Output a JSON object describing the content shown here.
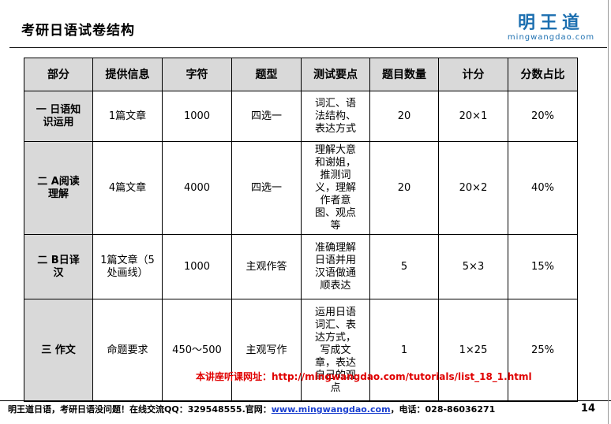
{
  "slide": {
    "title": "考研日语试卷结构",
    "logo_cn": "明王道",
    "logo_en": "mingwangdao.com",
    "page_number": "14"
  },
  "table": {
    "headers": [
      "部分",
      "提供信息",
      "字符",
      "题型",
      "测试要点",
      "题目数量",
      "计分",
      "分数占比"
    ],
    "rows": [
      {
        "part": "一 日语知识运用",
        "info": "1篇文章",
        "chars": "1000",
        "type": "四选一",
        "focus": "词汇、语法结构、表达方式",
        "count": "20",
        "score": "20×1",
        "ratio": "20%"
      },
      {
        "part": "二 A阅读理解",
        "info": "4篇文章",
        "chars": "4000",
        "type": "四选一",
        "focus": "理解大意和谢姐，推测词义，理解作者意图、观点等",
        "count": "20",
        "score": "20×2",
        "ratio": "40%"
      },
      {
        "part": "二 B日译汉",
        "info": "1篇文章（5处画线）",
        "chars": "1000",
        "type": "主观作答",
        "focus": "准确理解日语并用汉语做通顺表达",
        "count": "5",
        "score": "5×3",
        "ratio": "15%"
      },
      {
        "part": "三 作文",
        "info": "命题要求",
        "chars": "450～500",
        "type": "主观写作",
        "focus": "运用日语词汇、表达方式，写成文章，表达自己的观点",
        "count": "1",
        "score": "1×25",
        "ratio": "25%"
      }
    ]
  },
  "banner": {
    "text": "本讲座听课网址：http://mingwangdao.com/tutorials/list_18_1.html"
  },
  "footer": {
    "prefix": "明王道日语，考研日语没问题！在线交流QQ：329548555.官网：",
    "link": "www.mingwangdao.com",
    "suffix": "，电话：028-86036271"
  }
}
